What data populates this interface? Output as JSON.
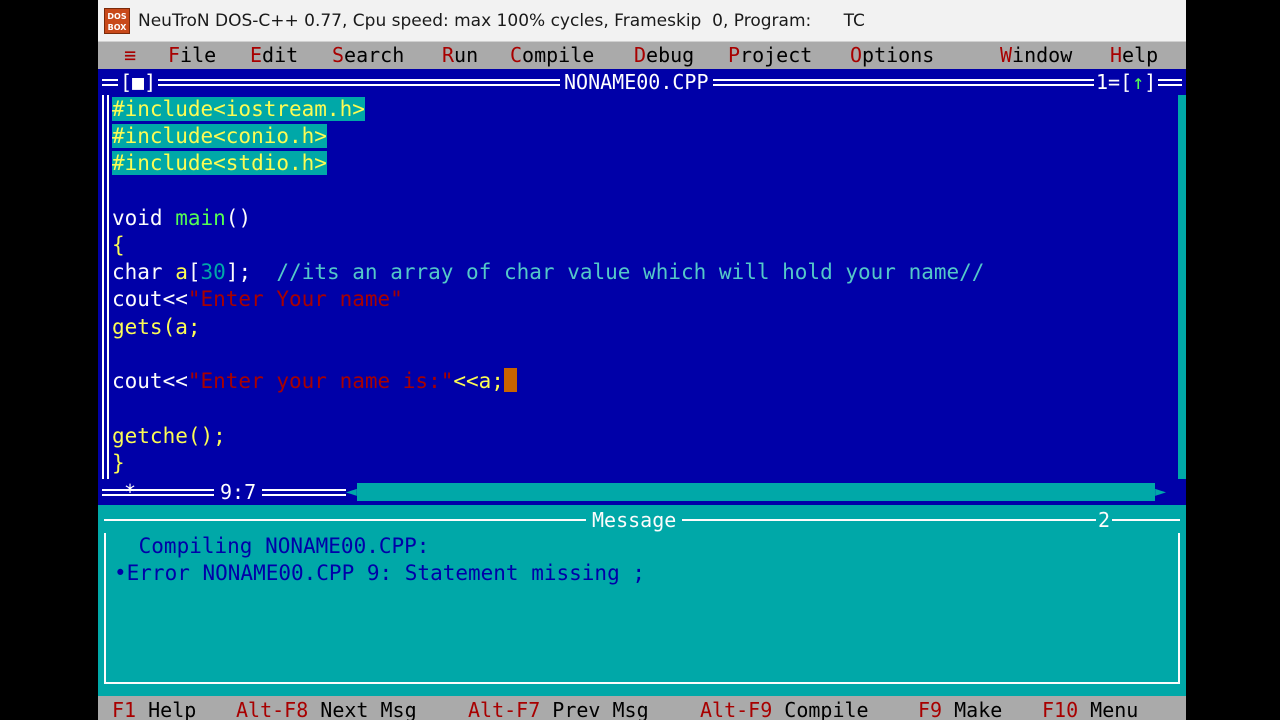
{
  "window": {
    "title": "NeuTroN DOS-C++ 0.77, Cpu speed: max 100% cycles, Frameskip  0, Program:      TC",
    "logo_text": "DOS BOX"
  },
  "menu": [
    {
      "hot": "F",
      "rest": "ile"
    },
    {
      "hot": "E",
      "rest": "dit"
    },
    {
      "hot": "S",
      "rest": "earch"
    },
    {
      "hot": "R",
      "rest": "un"
    },
    {
      "hot": "C",
      "rest": "ompile"
    },
    {
      "hot": "D",
      "rest": "ebug"
    },
    {
      "hot": "P",
      "rest": "roject"
    },
    {
      "hot": "O",
      "rest": "ptions"
    },
    {
      "hot": "W",
      "rest": "indow"
    },
    {
      "hot": "H",
      "rest": "elp"
    }
  ],
  "editor": {
    "filename": "NONAME00.CPP",
    "close_box": "[■]",
    "window_number": "1",
    "zoom_arrow": "↑",
    "cursor_position": "9:7",
    "code": {
      "include1": "#include<iostream.h>",
      "include2": "#include<conio.h>",
      "include3": "#include<stdio.h>",
      "main_kw": "void",
      "main_name": " main",
      "main_parens": "()",
      "open_brace": "{",
      "decl_kw": "char",
      "decl_id": " a",
      "decl_bracket_open": "[",
      "decl_num": "30",
      "decl_bracket_close": "];",
      "decl_comment": "  //its an array of char value which will hold your name//",
      "cout1_kw": "cout<<",
      "cout1_str": "\"Enter Your name\"",
      "gets_text": "gets(a;",
      "cout2_kw": "cout<<",
      "cout2_str": "\"Enter your name is:\"",
      "cout2_tail": "<<a;",
      "getche_text": "getche();",
      "close_brace": "}"
    }
  },
  "message": {
    "title": "Message",
    "window_number": "2",
    "lines": [
      " Compiling NONAME00.CPP:",
      "•Error NONAME00.CPP 9: Statement missing ;"
    ]
  },
  "statusbar": [
    {
      "key": "F1",
      "label": " Help"
    },
    {
      "key": "Alt-F8",
      "label": " Next Msg"
    },
    {
      "key": "Alt-F7",
      "label": " Prev Msg"
    },
    {
      "key": "Alt-F9",
      "label": " Compile"
    },
    {
      "key": "F9",
      "label": " Make"
    },
    {
      "key": "F10",
      "label": " Menu"
    }
  ],
  "colors": {
    "editor_bg": "#0000a8",
    "message_bg": "#00a8a8",
    "menu_bg": "#aaaaaa",
    "hotkey": "#a80000",
    "keyword": "#fcfcfc",
    "identifier": "#fcfc54",
    "string": "#a80000",
    "cursor": "#c86400"
  }
}
